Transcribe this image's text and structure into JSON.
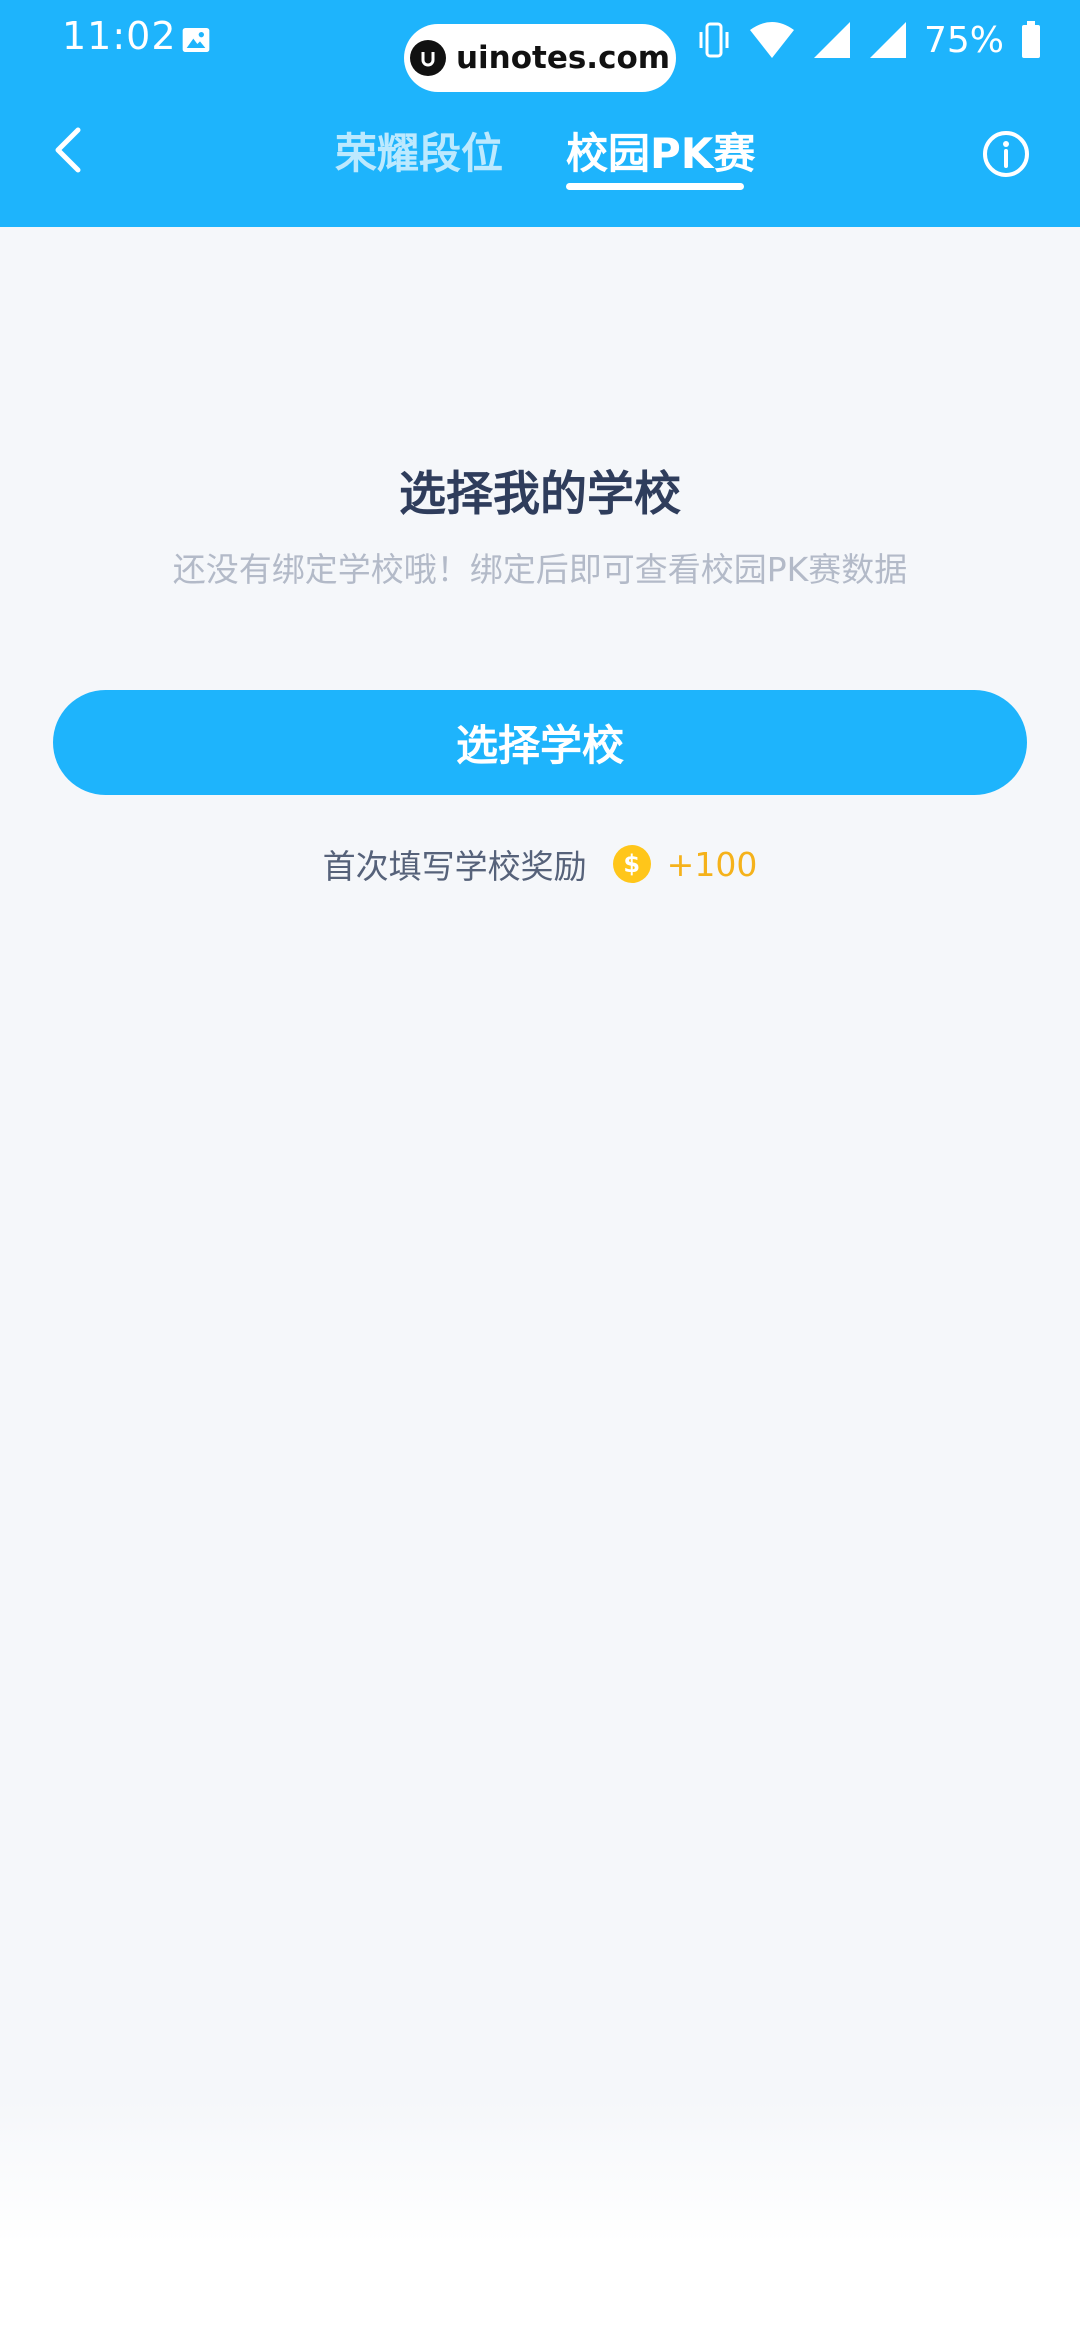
{
  "status_bar": {
    "time": "11:02",
    "battery_percent": "75%",
    "icons": [
      "photo-icon",
      "vibrate-icon",
      "wifi-icon",
      "signal-icon",
      "signal-icon",
      "battery-icon"
    ]
  },
  "watermark": {
    "text": "uinotes.com"
  },
  "nav": {
    "tabs": [
      {
        "label": "荣耀段位",
        "active": false
      },
      {
        "label": "校园PK赛",
        "active": true
      }
    ],
    "back_icon": "chevron-left-icon",
    "info_icon": "info-icon"
  },
  "main": {
    "title": "选择我的学校",
    "subtitle": "还没有绑定学校哦！绑定后即可查看校园PK赛数据",
    "select_button_label": "选择学校",
    "reward_label": "首次填写学校奖励",
    "coin_symbol": "$",
    "reward_value": "+100"
  },
  "colors": {
    "brand": "#1eb4fc",
    "title": "#2f3d5c",
    "subtitle": "#b3bac8",
    "reward": "#f5b21b",
    "coin": "#ffc61a",
    "background": "#f5f7fa"
  }
}
